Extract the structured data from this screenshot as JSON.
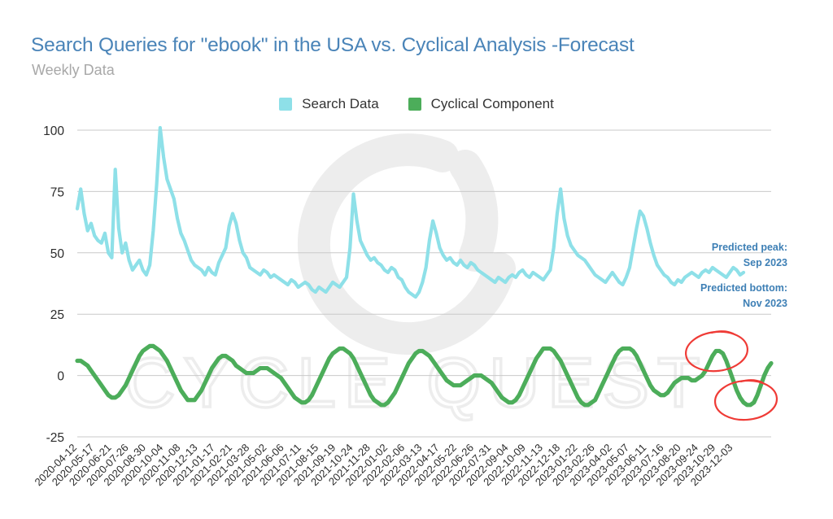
{
  "header": {
    "title": "Search Queries for \"ebook\" in the USA vs. Cyclical Analysis -Forecast",
    "subtitle": "Weekly Data",
    "title_color": "#4a84b8",
    "subtitle_color": "#a8a8a8"
  },
  "legend": {
    "position": "top-center",
    "items": [
      {
        "label": "Search Data",
        "color": "#8ee0e8"
      },
      {
        "label": "Cyclical Component",
        "color": "#4cad5a"
      }
    ]
  },
  "annotations": {
    "peak": {
      "line1": "Predicted peak:",
      "line2": "Sep 2023",
      "color": "#3d7fb5"
    },
    "bottom": {
      "line1": "Predicted bottom:",
      "line2": "Nov 2023",
      "color": "#3d7fb5"
    },
    "highlight_color": "#ef3b36",
    "circles": [
      {
        "name": "predicted-peak-circle",
        "cx": 881,
        "cy": 432,
        "rx": 38,
        "ry": 24,
        "rot": -6
      },
      {
        "name": "predicted-bottom-circle",
        "cx": 917,
        "cy": 492,
        "rx": 38,
        "ry": 24,
        "rot": -4
      }
    ]
  },
  "watermark": {
    "text": "CYCLE QUEST",
    "logo": "cycle-quest-logo",
    "color": "#ededed"
  },
  "chart_data": {
    "type": "line",
    "title": "Search Queries for \"ebook\" in the USA vs. Cyclical Analysis -Forecast",
    "subtitle": "Weekly Data",
    "xlabel": "",
    "ylabel": "",
    "ylim": [
      -30,
      105
    ],
    "yticks": [
      100,
      75,
      50,
      25,
      0,
      -25
    ],
    "grid": true,
    "tick_step_weeks": 5,
    "tick_labels": [
      "2020-04-12",
      "2020-05-17",
      "2020-06-21",
      "2020-07-26",
      "2020-08-30",
      "2020-10-04",
      "2020-11-08",
      "2020-12-13",
      "2021-01-17",
      "2021-02-21",
      "2021-03-28",
      "2021-05-02",
      "2021-06-06",
      "2021-07-11",
      "2021-08-15",
      "2021-09-19",
      "2021-10-24",
      "2021-11-28",
      "2022-01-02",
      "2022-02-06",
      "2022-03-13",
      "2022-04-17",
      "2022-05-22",
      "2022-06-26",
      "2022-07-31",
      "2022-09-04",
      "2022-10-09",
      "2022-11-13",
      "2022-12-18",
      "2023-01-22",
      "2023-02-26",
      "2023-04-02",
      "2023-05-07",
      "2023-06-11",
      "2023-07-16",
      "2023-08-20",
      "2023-09-24",
      "2023-10-29",
      "2023-12-03"
    ],
    "series": [
      {
        "name": "Search Data",
        "color": "#8ee0e8",
        "values": [
          68,
          76,
          66,
          59,
          62,
          57,
          55,
          54,
          58,
          50,
          48,
          84,
          60,
          50,
          54,
          47,
          43,
          45,
          47,
          43,
          41,
          45,
          59,
          78,
          101,
          89,
          80,
          76,
          72,
          64,
          58,
          55,
          51,
          47,
          45,
          44,
          43,
          41,
          44,
          42,
          41,
          46,
          49,
          52,
          61,
          66,
          62,
          55,
          50,
          48,
          44,
          43,
          42,
          41,
          43,
          42,
          40,
          41,
          40,
          39,
          38,
          37,
          39,
          38,
          36,
          37,
          38,
          37,
          35,
          34,
          36,
          35,
          34,
          36,
          38,
          37,
          36,
          38,
          40,
          52,
          74,
          63,
          55,
          52,
          49,
          47,
          48,
          46,
          45,
          43,
          42,
          44,
          43,
          40,
          39,
          36,
          34,
          33,
          32,
          34,
          38,
          44,
          55,
          63,
          58,
          52,
          49,
          47,
          48,
          46,
          45,
          47,
          45,
          44,
          46,
          45,
          43,
          42,
          41,
          40,
          39,
          38,
          40,
          39,
          38,
          40,
          41,
          40,
          42,
          43,
          41,
          40,
          42,
          41,
          40,
          39,
          41,
          43,
          52,
          66,
          76,
          64,
          57,
          53,
          51,
          49,
          48,
          47,
          45,
          43,
          41,
          40,
          39,
          38,
          40,
          42,
          40,
          38,
          37,
          40,
          44,
          52,
          60,
          67,
          65,
          60,
          54,
          49,
          45,
          43,
          41,
          40,
          38,
          37,
          39,
          38,
          40,
          41,
          42,
          41,
          40,
          42,
          43,
          42,
          44,
          43,
          42,
          41,
          40,
          42,
          44,
          43,
          41,
          42
        ]
      },
      {
        "name": "Cyclical Component",
        "color": "#4cad5a",
        "values": [
          6,
          6,
          5,
          4,
          2,
          0,
          -2,
          -4,
          -6,
          -8,
          -9,
          -9,
          -8,
          -6,
          -4,
          -1,
          2,
          5,
          8,
          10,
          11,
          12,
          12,
          11,
          10,
          8,
          6,
          3,
          0,
          -3,
          -6,
          -8,
          -10,
          -10,
          -10,
          -8,
          -6,
          -3,
          0,
          3,
          5,
          7,
          8,
          8,
          7,
          6,
          4,
          3,
          2,
          1,
          1,
          1,
          2,
          3,
          3,
          3,
          2,
          1,
          0,
          -1,
          -3,
          -5,
          -7,
          -9,
          -10,
          -11,
          -11,
          -10,
          -8,
          -5,
          -2,
          1,
          4,
          7,
          9,
          10,
          11,
          11,
          10,
          9,
          7,
          4,
          1,
          -2,
          -5,
          -8,
          -10,
          -11,
          -12,
          -12,
          -11,
          -9,
          -7,
          -4,
          -1,
          2,
          5,
          7,
          9,
          10,
          10,
          9,
          8,
          6,
          4,
          2,
          0,
          -2,
          -3,
          -4,
          -4,
          -4,
          -3,
          -2,
          -1,
          0,
          0,
          0,
          -1,
          -2,
          -3,
          -5,
          -7,
          -9,
          -10,
          -11,
          -11,
          -10,
          -8,
          -5,
          -2,
          1,
          4,
          7,
          9,
          11,
          11,
          11,
          10,
          8,
          6,
          3,
          0,
          -3,
          -6,
          -9,
          -11,
          -12,
          -12,
          -11,
          -10,
          -7,
          -4,
          -1,
          2,
          5,
          8,
          10,
          11,
          11,
          11,
          10,
          8,
          5,
          2,
          -1,
          -4,
          -6,
          -7,
          -8,
          -8,
          -7,
          -5,
          -3,
          -2,
          -1,
          -1,
          -1,
          -2,
          -2,
          -1,
          0,
          2,
          5,
          8,
          10,
          10,
          9,
          6,
          2,
          -2,
          -6,
          -9,
          -11,
          -12,
          -12,
          -11,
          -8,
          -4,
          0,
          3,
          5
        ]
      }
    ]
  }
}
